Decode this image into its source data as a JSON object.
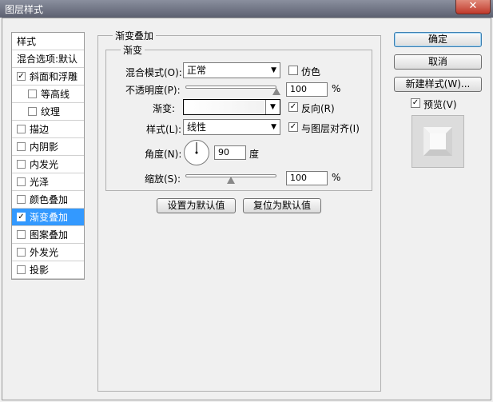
{
  "window": {
    "title": "图层样式",
    "close_label": "✕"
  },
  "sidebar": {
    "header": "样式",
    "items": [
      {
        "label": "混合选项:默认",
        "checkbox": false
      },
      {
        "label": "斜面和浮雕",
        "checkbox": true,
        "checked": true
      },
      {
        "label": "等高线",
        "checkbox": true,
        "checked": false,
        "sub": true
      },
      {
        "label": "纹理",
        "checkbox": true,
        "checked": false,
        "sub": true
      },
      {
        "label": "描边",
        "checkbox": true,
        "checked": false
      },
      {
        "label": "内阴影",
        "checkbox": true,
        "checked": false
      },
      {
        "label": "内发光",
        "checkbox": true,
        "checked": false
      },
      {
        "label": "光泽",
        "checkbox": true,
        "checked": false
      },
      {
        "label": "颜色叠加",
        "checkbox": true,
        "checked": false
      },
      {
        "label": "渐变叠加",
        "checkbox": true,
        "checked": true,
        "selected": true
      },
      {
        "label": "图案叠加",
        "checkbox": true,
        "checked": false
      },
      {
        "label": "外发光",
        "checkbox": true,
        "checked": false
      },
      {
        "label": "投影",
        "checkbox": true,
        "checked": false
      }
    ]
  },
  "panel": {
    "group_title": "渐变叠加",
    "inner_title": "渐变",
    "blend_mode": {
      "label": "混合模式(O):",
      "value": "正常"
    },
    "dither": {
      "label": "仿色",
      "checked": false
    },
    "opacity": {
      "label": "不透明度(P):",
      "value": "100",
      "unit": "%",
      "fraction": 1.0
    },
    "gradient": {
      "label": "渐变:"
    },
    "reverse": {
      "label": "反向(R)",
      "checked": true
    },
    "style": {
      "label": "样式(L):",
      "value": "线性"
    },
    "align": {
      "label": "与图层对齐(I)",
      "checked": true
    },
    "angle": {
      "label": "角度(N):",
      "value": "90",
      "unit": "度",
      "degrees": 90
    },
    "scale": {
      "label": "缩放(S):",
      "value": "100",
      "unit": "%",
      "fraction": 0.5
    },
    "make_default": "设置为默认值",
    "reset_default": "复位为默认值"
  },
  "actions": {
    "ok": "确定",
    "cancel": "取消",
    "new_style": "新建样式(W)...",
    "preview": {
      "label": "预览(V)",
      "checked": true
    }
  },
  "check_mark": "✓"
}
